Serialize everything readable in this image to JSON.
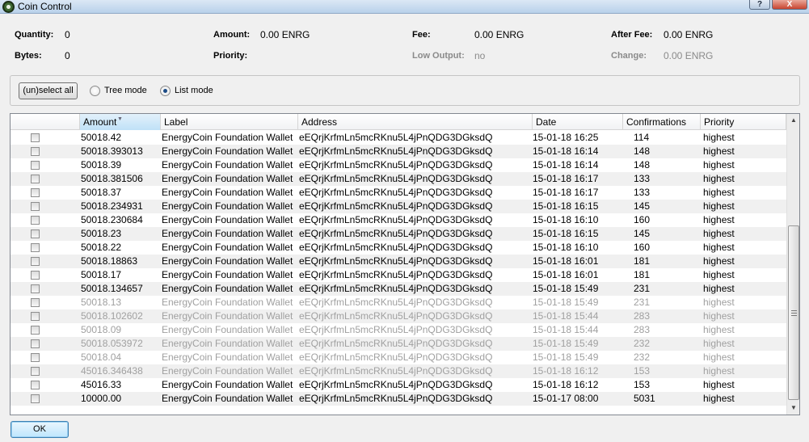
{
  "window": {
    "title": "Coin Control",
    "help": "?",
    "close": "X"
  },
  "summary": {
    "quantity_label": "Quantity:",
    "quantity": "0",
    "bytes_label": "Bytes:",
    "bytes": "0",
    "amount_label": "Amount:",
    "amount": "0.00 ENRG",
    "priority_label": "Priority:",
    "priority": "",
    "fee_label": "Fee:",
    "fee": "0.00 ENRG",
    "low_output_label": "Low Output:",
    "low_output": "no",
    "after_fee_label": "After Fee:",
    "after_fee": "0.00 ENRG",
    "change_label": "Change:",
    "change": "0.00 ENRG"
  },
  "mode": {
    "unselect_all": "(un)select all",
    "tree_mode": "Tree mode",
    "list_mode": "List mode",
    "selected": "list"
  },
  "table": {
    "columns": [
      "Amount",
      "Label",
      "Address",
      "Date",
      "Confirmations",
      "Priority"
    ],
    "sorted_column": "Amount",
    "rows": [
      {
        "amount": "50018.42",
        "label": "EnergyCoin Foundation Wallet",
        "address": "eEQrjKrfmLn5mcRKnu5L4jPnQDG3DGksdQ",
        "date": "15-01-18 16:25",
        "confirmations": "114",
        "priority": "highest",
        "locked": false
      },
      {
        "amount": "50018.393013",
        "label": "EnergyCoin Foundation Wallet",
        "address": "eEQrjKrfmLn5mcRKnu5L4jPnQDG3DGksdQ",
        "date": "15-01-18 16:14",
        "confirmations": "148",
        "priority": "highest",
        "locked": false
      },
      {
        "amount": "50018.39",
        "label": "EnergyCoin Foundation Wallet",
        "address": "eEQrjKrfmLn5mcRKnu5L4jPnQDG3DGksdQ",
        "date": "15-01-18 16:14",
        "confirmations": "148",
        "priority": "highest",
        "locked": false
      },
      {
        "amount": "50018.381506",
        "label": "EnergyCoin Foundation Wallet",
        "address": "eEQrjKrfmLn5mcRKnu5L4jPnQDG3DGksdQ",
        "date": "15-01-18 16:17",
        "confirmations": "133",
        "priority": "highest",
        "locked": false
      },
      {
        "amount": "50018.37",
        "label": "EnergyCoin Foundation Wallet",
        "address": "eEQrjKrfmLn5mcRKnu5L4jPnQDG3DGksdQ",
        "date": "15-01-18 16:17",
        "confirmations": "133",
        "priority": "highest",
        "locked": false
      },
      {
        "amount": "50018.234931",
        "label": "EnergyCoin Foundation Wallet",
        "address": "eEQrjKrfmLn5mcRKnu5L4jPnQDG3DGksdQ",
        "date": "15-01-18 16:15",
        "confirmations": "145",
        "priority": "highest",
        "locked": false
      },
      {
        "amount": "50018.230684",
        "label": "EnergyCoin Foundation Wallet",
        "address": "eEQrjKrfmLn5mcRKnu5L4jPnQDG3DGksdQ",
        "date": "15-01-18 16:10",
        "confirmations": "160",
        "priority": "highest",
        "locked": false
      },
      {
        "amount": "50018.23",
        "label": "EnergyCoin Foundation Wallet",
        "address": "eEQrjKrfmLn5mcRKnu5L4jPnQDG3DGksdQ",
        "date": "15-01-18 16:15",
        "confirmations": "145",
        "priority": "highest",
        "locked": false
      },
      {
        "amount": "50018.22",
        "label": "EnergyCoin Foundation Wallet",
        "address": "eEQrjKrfmLn5mcRKnu5L4jPnQDG3DGksdQ",
        "date": "15-01-18 16:10",
        "confirmations": "160",
        "priority": "highest",
        "locked": false
      },
      {
        "amount": "50018.18863",
        "label": "EnergyCoin Foundation Wallet",
        "address": "eEQrjKrfmLn5mcRKnu5L4jPnQDG3DGksdQ",
        "date": "15-01-18 16:01",
        "confirmations": "181",
        "priority": "highest",
        "locked": false
      },
      {
        "amount": "50018.17",
        "label": "EnergyCoin Foundation Wallet",
        "address": "eEQrjKrfmLn5mcRKnu5L4jPnQDG3DGksdQ",
        "date": "15-01-18 16:01",
        "confirmations": "181",
        "priority": "highest",
        "locked": false
      },
      {
        "amount": "50018.134657",
        "label": "EnergyCoin Foundation Wallet",
        "address": "eEQrjKrfmLn5mcRKnu5L4jPnQDG3DGksdQ",
        "date": "15-01-18 15:49",
        "confirmations": "231",
        "priority": "highest",
        "locked": false
      },
      {
        "amount": "50018.13",
        "label": "EnergyCoin Foundation Wallet",
        "address": "eEQrjKrfmLn5mcRKnu5L4jPnQDG3DGksdQ",
        "date": "15-01-18 15:49",
        "confirmations": "231",
        "priority": "highest",
        "locked": true
      },
      {
        "amount": "50018.102602",
        "label": "EnergyCoin Foundation Wallet",
        "address": "eEQrjKrfmLn5mcRKnu5L4jPnQDG3DGksdQ",
        "date": "15-01-18 15:44",
        "confirmations": "283",
        "priority": "highest",
        "locked": true
      },
      {
        "amount": "50018.09",
        "label": "EnergyCoin Foundation Wallet",
        "address": "eEQrjKrfmLn5mcRKnu5L4jPnQDG3DGksdQ",
        "date": "15-01-18 15:44",
        "confirmations": "283",
        "priority": "highest",
        "locked": true
      },
      {
        "amount": "50018.053972",
        "label": "EnergyCoin Foundation Wallet",
        "address": "eEQrjKrfmLn5mcRKnu5L4jPnQDG3DGksdQ",
        "date": "15-01-18 15:49",
        "confirmations": "232",
        "priority": "highest",
        "locked": true
      },
      {
        "amount": "50018.04",
        "label": "EnergyCoin Foundation Wallet",
        "address": "eEQrjKrfmLn5mcRKnu5L4jPnQDG3DGksdQ",
        "date": "15-01-18 15:49",
        "confirmations": "232",
        "priority": "highest",
        "locked": true
      },
      {
        "amount": "45016.346438",
        "label": "EnergyCoin Foundation Wallet",
        "address": "eEQrjKrfmLn5mcRKnu5L4jPnQDG3DGksdQ",
        "date": "15-01-18 16:12",
        "confirmations": "153",
        "priority": "highest",
        "locked": true
      },
      {
        "amount": "45016.33",
        "label": "EnergyCoin Foundation Wallet",
        "address": "eEQrjKrfmLn5mcRKnu5L4jPnQDG3DGksdQ",
        "date": "15-01-18 16:12",
        "confirmations": "153",
        "priority": "highest",
        "locked": false
      },
      {
        "amount": "10000.00",
        "label": "EnergyCoin Foundation Wallet",
        "address": "eEQrjKrfmLn5mcRKnu5L4jPnQDG3DGksdQ",
        "date": "15-01-17 08:00",
        "confirmations": "5031",
        "priority": "highest",
        "locked": false
      }
    ]
  },
  "footer": {
    "ok": "OK"
  },
  "colors": {
    "locked_text": "#a0a0a0",
    "accent": "#3c7fb1"
  }
}
